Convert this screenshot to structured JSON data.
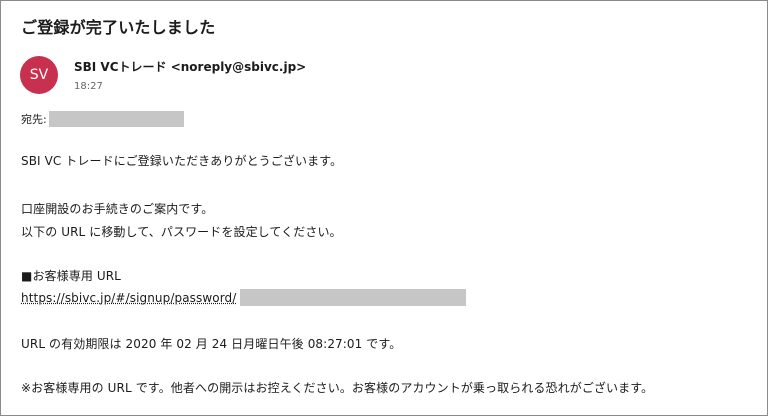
{
  "email": {
    "subject": "ご登録が完了いたしました",
    "avatar_initials": "SV",
    "avatar_color": "#c8304f",
    "sender": "SBI VCトレード <noreply@sbivc.jp>",
    "time": "18:27",
    "to_label": "宛先:",
    "body": {
      "greeting": "SBI VC トレードにご登録いただきありがとうございます。",
      "guide_1": "口座開設のお手続きのご案内です。",
      "guide_2": "以下の URL に移動して、パスワードを設定してください。",
      "url_heading": "■お客様専用 URL",
      "url_link": "https://sbivc.jp/#/signup/password/",
      "expiry": "URL の有効期限は 2020 年 02 月 24 日月曜日午後 08:27:01 です。",
      "notice": "※お客様専用の URL です。他者への開示はお控えください。お客様のアカウントが乗っ取られる恐れがございます。"
    }
  }
}
